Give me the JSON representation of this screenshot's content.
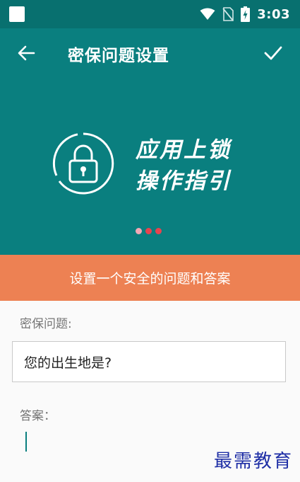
{
  "status_bar": {
    "time": "3:03",
    "icons": [
      "notification-icon",
      "wifi-icon",
      "no-sim-icon",
      "battery-charging-icon"
    ]
  },
  "app_bar": {
    "title": "密保问题设置",
    "back_icon": "arrow-left-icon",
    "confirm_icon": "check-icon"
  },
  "hero": {
    "icon": "lock-icon",
    "text_line1": "应用上锁",
    "text_line2": "操作指引",
    "dots": [
      {
        "color": "#f3a9b6"
      },
      {
        "color": "#e8434f"
      },
      {
        "color": "#e8434f"
      }
    ]
  },
  "banner": {
    "text": "设置一个安全的问题和答案",
    "color": "#ed8153"
  },
  "form": {
    "question_label": "密保问题:",
    "question_value": "您的出生地是?",
    "answer_label": "答案：",
    "answer_value": ""
  },
  "watermark": "最需教育",
  "colors": {
    "primary": "#0a7f7f",
    "status_bar": "#08706f",
    "accent": "#ed8153"
  }
}
